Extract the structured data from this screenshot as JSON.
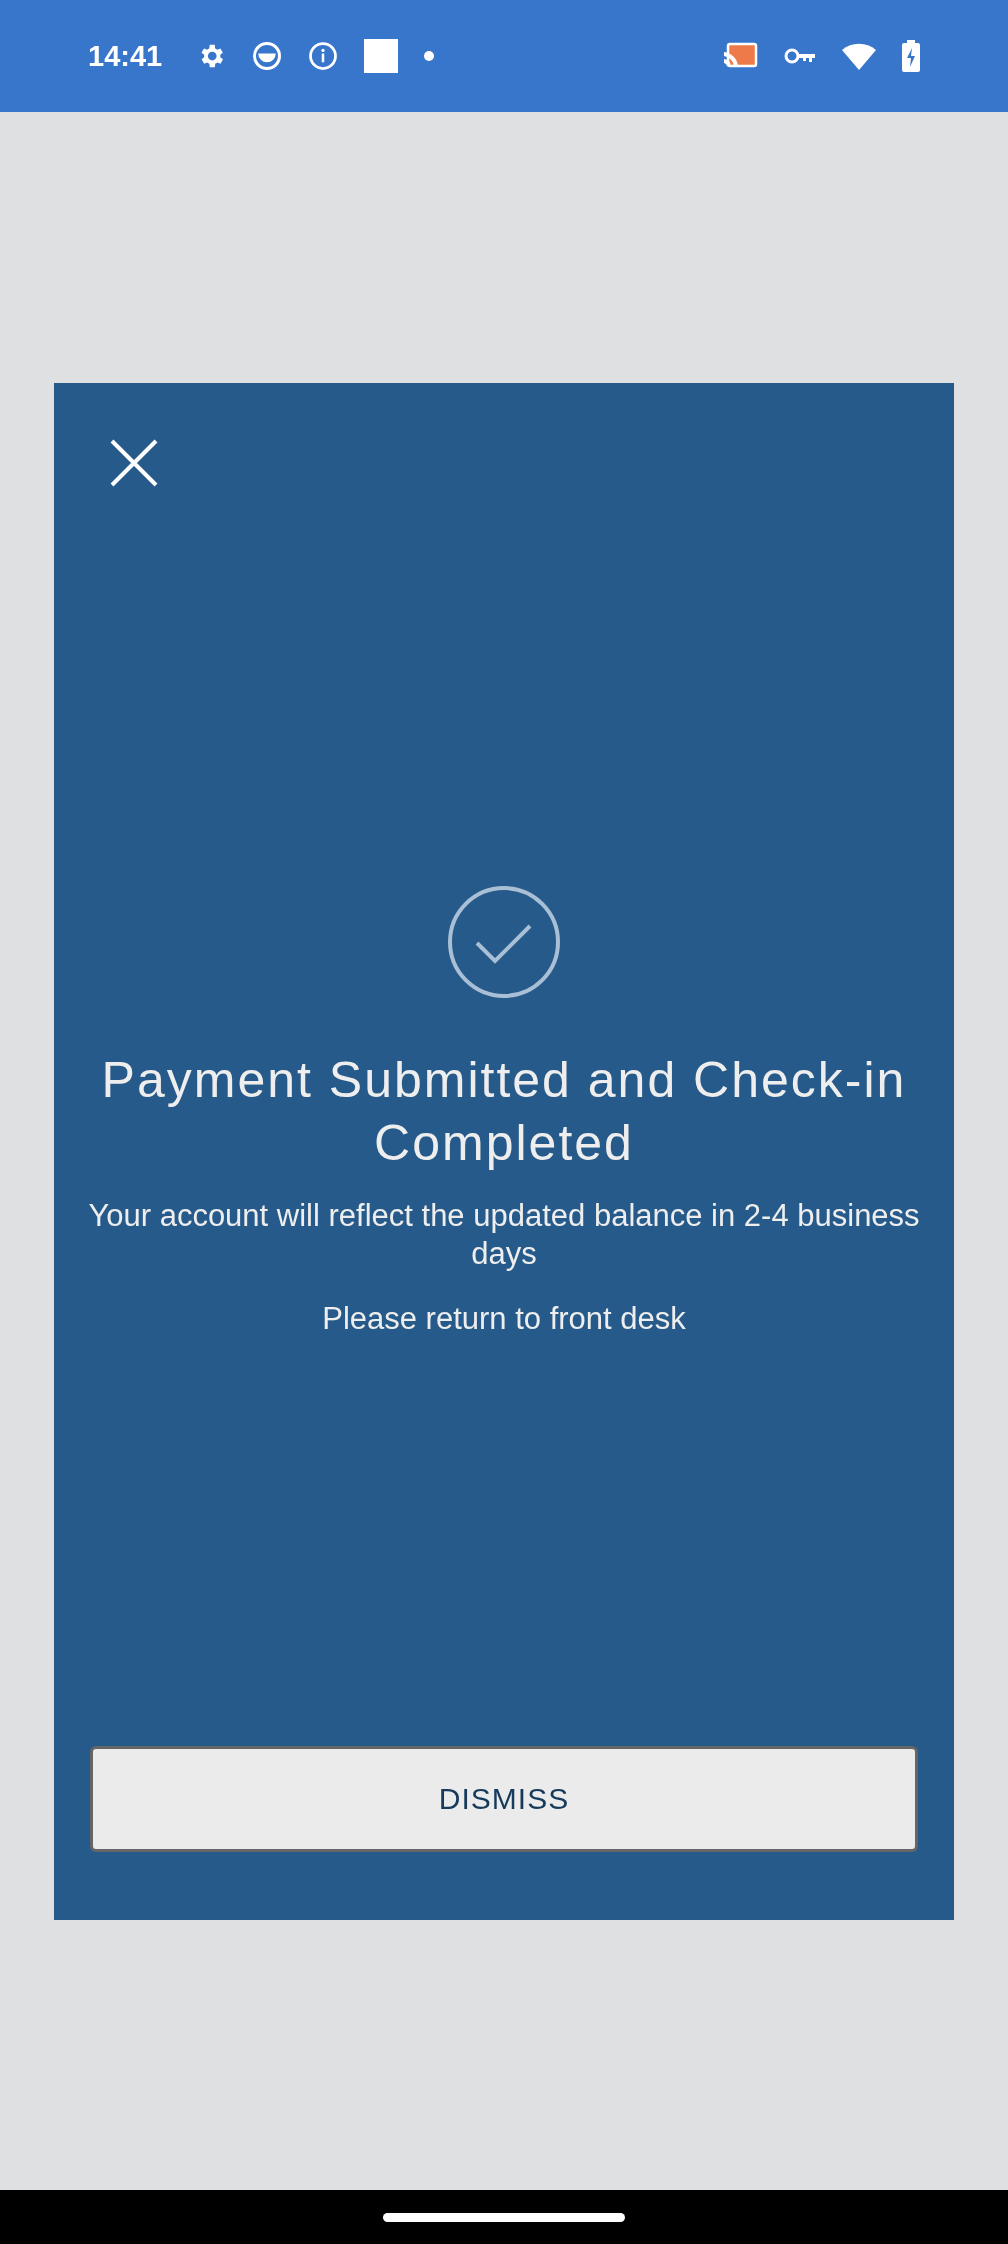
{
  "status_bar": {
    "time": "14:41"
  },
  "dialog": {
    "title": "Payment Submitted and Check-in Completed",
    "message": "Your account will reflect the updated balance in 2-4 business days",
    "note": "Please return to front desk",
    "button": "DISMISS"
  }
}
